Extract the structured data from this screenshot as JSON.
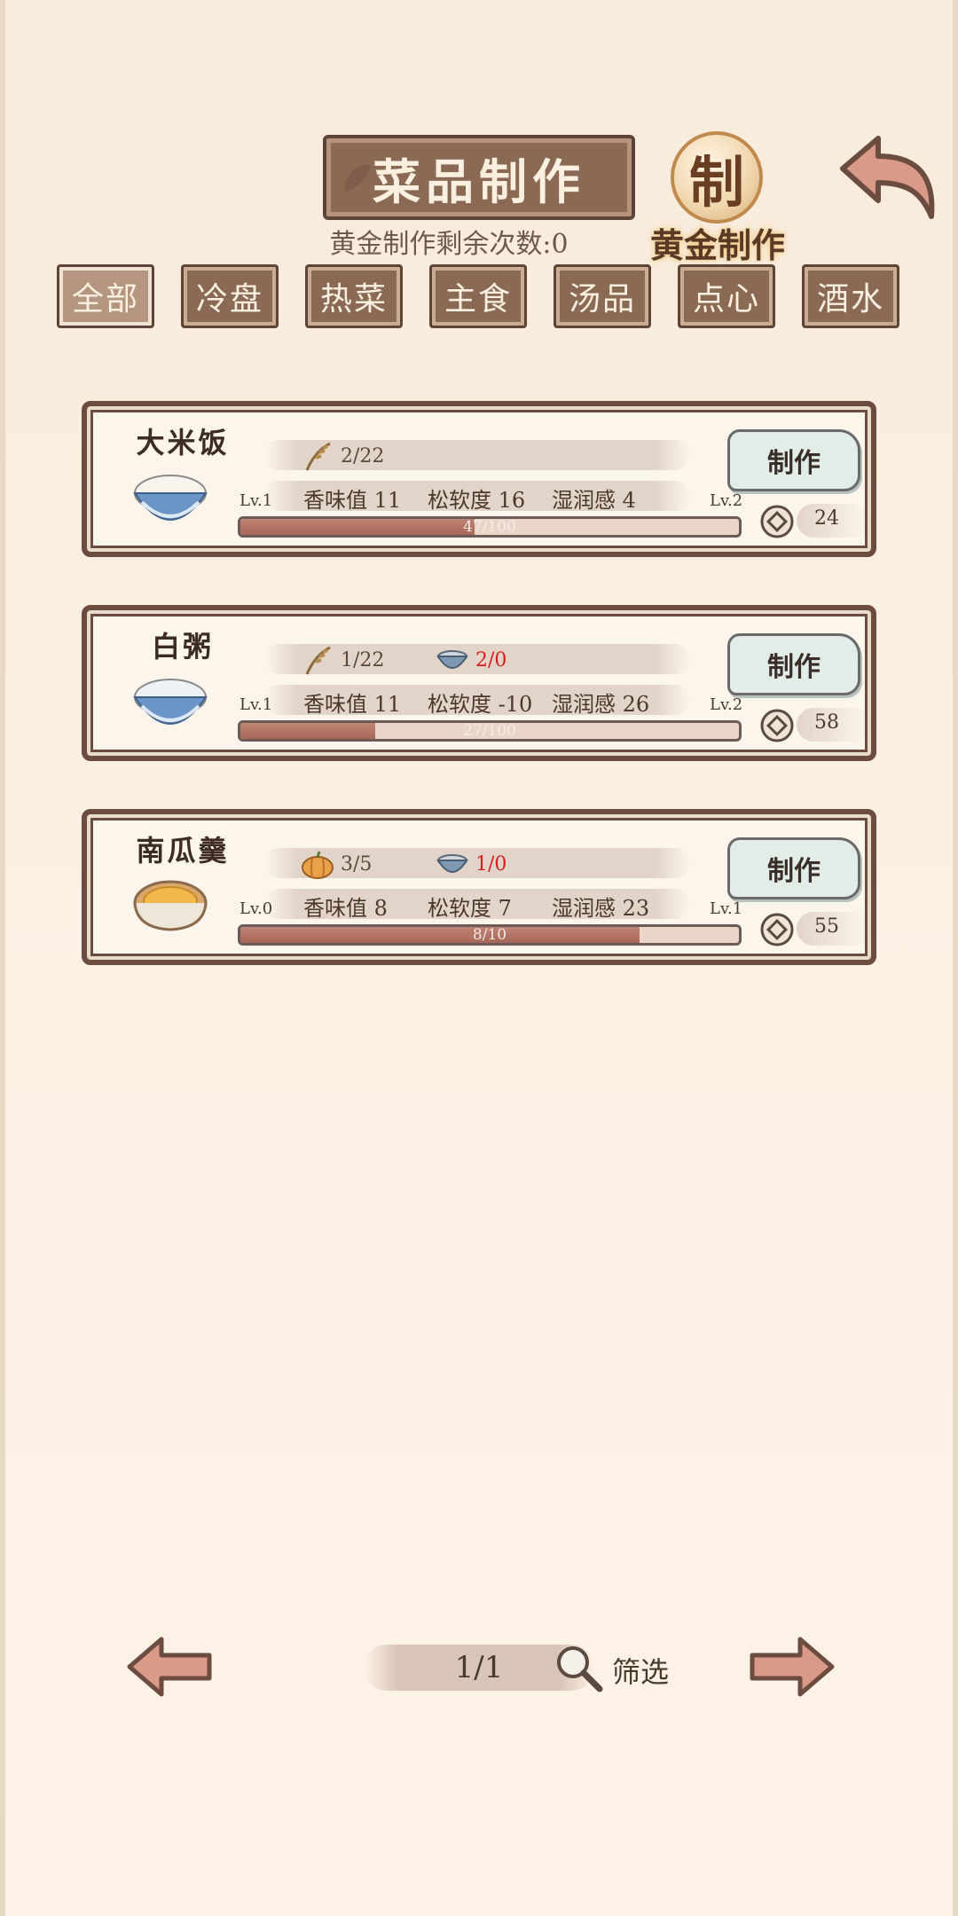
{
  "header": {
    "title": "菜品制作",
    "gold_count_text": "黄金制作剩余次数:0",
    "gold_button_label": "黄金制作",
    "gold_coin_glyph": "制"
  },
  "tabs": [
    {
      "label": "全部",
      "active": true
    },
    {
      "label": "冷盘",
      "active": false
    },
    {
      "label": "热菜",
      "active": false
    },
    {
      "label": "主食",
      "active": false
    },
    {
      "label": "汤品",
      "active": false
    },
    {
      "label": "点心",
      "active": false
    },
    {
      "label": "酒水",
      "active": false
    }
  ],
  "recipes": [
    {
      "name": "大米饭",
      "ingredient1": {
        "icon": "rice-stalk-icon",
        "count": "2/22"
      },
      "ingredient2": null,
      "stats": {
        "aroma": "香味值 11",
        "softness": "松软度 16",
        "moisture": "湿润感 4"
      },
      "lv_current": "Lv.1",
      "lv_next": "Lv.2",
      "progress_text": "47/100",
      "progress": 0.47,
      "make_label": "制作",
      "cost": "24"
    },
    {
      "name": "白粥",
      "ingredient1": {
        "icon": "rice-stalk-icon",
        "count": "1/22"
      },
      "ingredient2": {
        "icon": "bowl-icon",
        "count": "2/0"
      },
      "stats": {
        "aroma": "香味值 11",
        "softness": "松软度 -10",
        "moisture": "湿润感 26"
      },
      "lv_current": "Lv.1",
      "lv_next": "Lv.2",
      "progress_text": "27/100",
      "progress": 0.27,
      "make_label": "制作",
      "cost": "58"
    },
    {
      "name": "南瓜羹",
      "ingredient1": {
        "icon": "pumpkin-icon",
        "count": "3/5"
      },
      "ingredient2": {
        "icon": "bowl-icon",
        "count": "1/0"
      },
      "stats": {
        "aroma": "香味值 8",
        "softness": "松软度 7",
        "moisture": "湿润感 23"
      },
      "lv_current": "Lv.0",
      "lv_next": "Lv.1",
      "progress_text": "8/10",
      "progress": 0.8,
      "make_label": "制作",
      "cost": "55"
    }
  ],
  "footer": {
    "page": "1/1",
    "filter_label": "筛选"
  },
  "colors": {
    "plaque": "#8b6a55",
    "border": "#6b4c3e",
    "progress": "#a8665a",
    "warning": "#d71d1d"
  }
}
